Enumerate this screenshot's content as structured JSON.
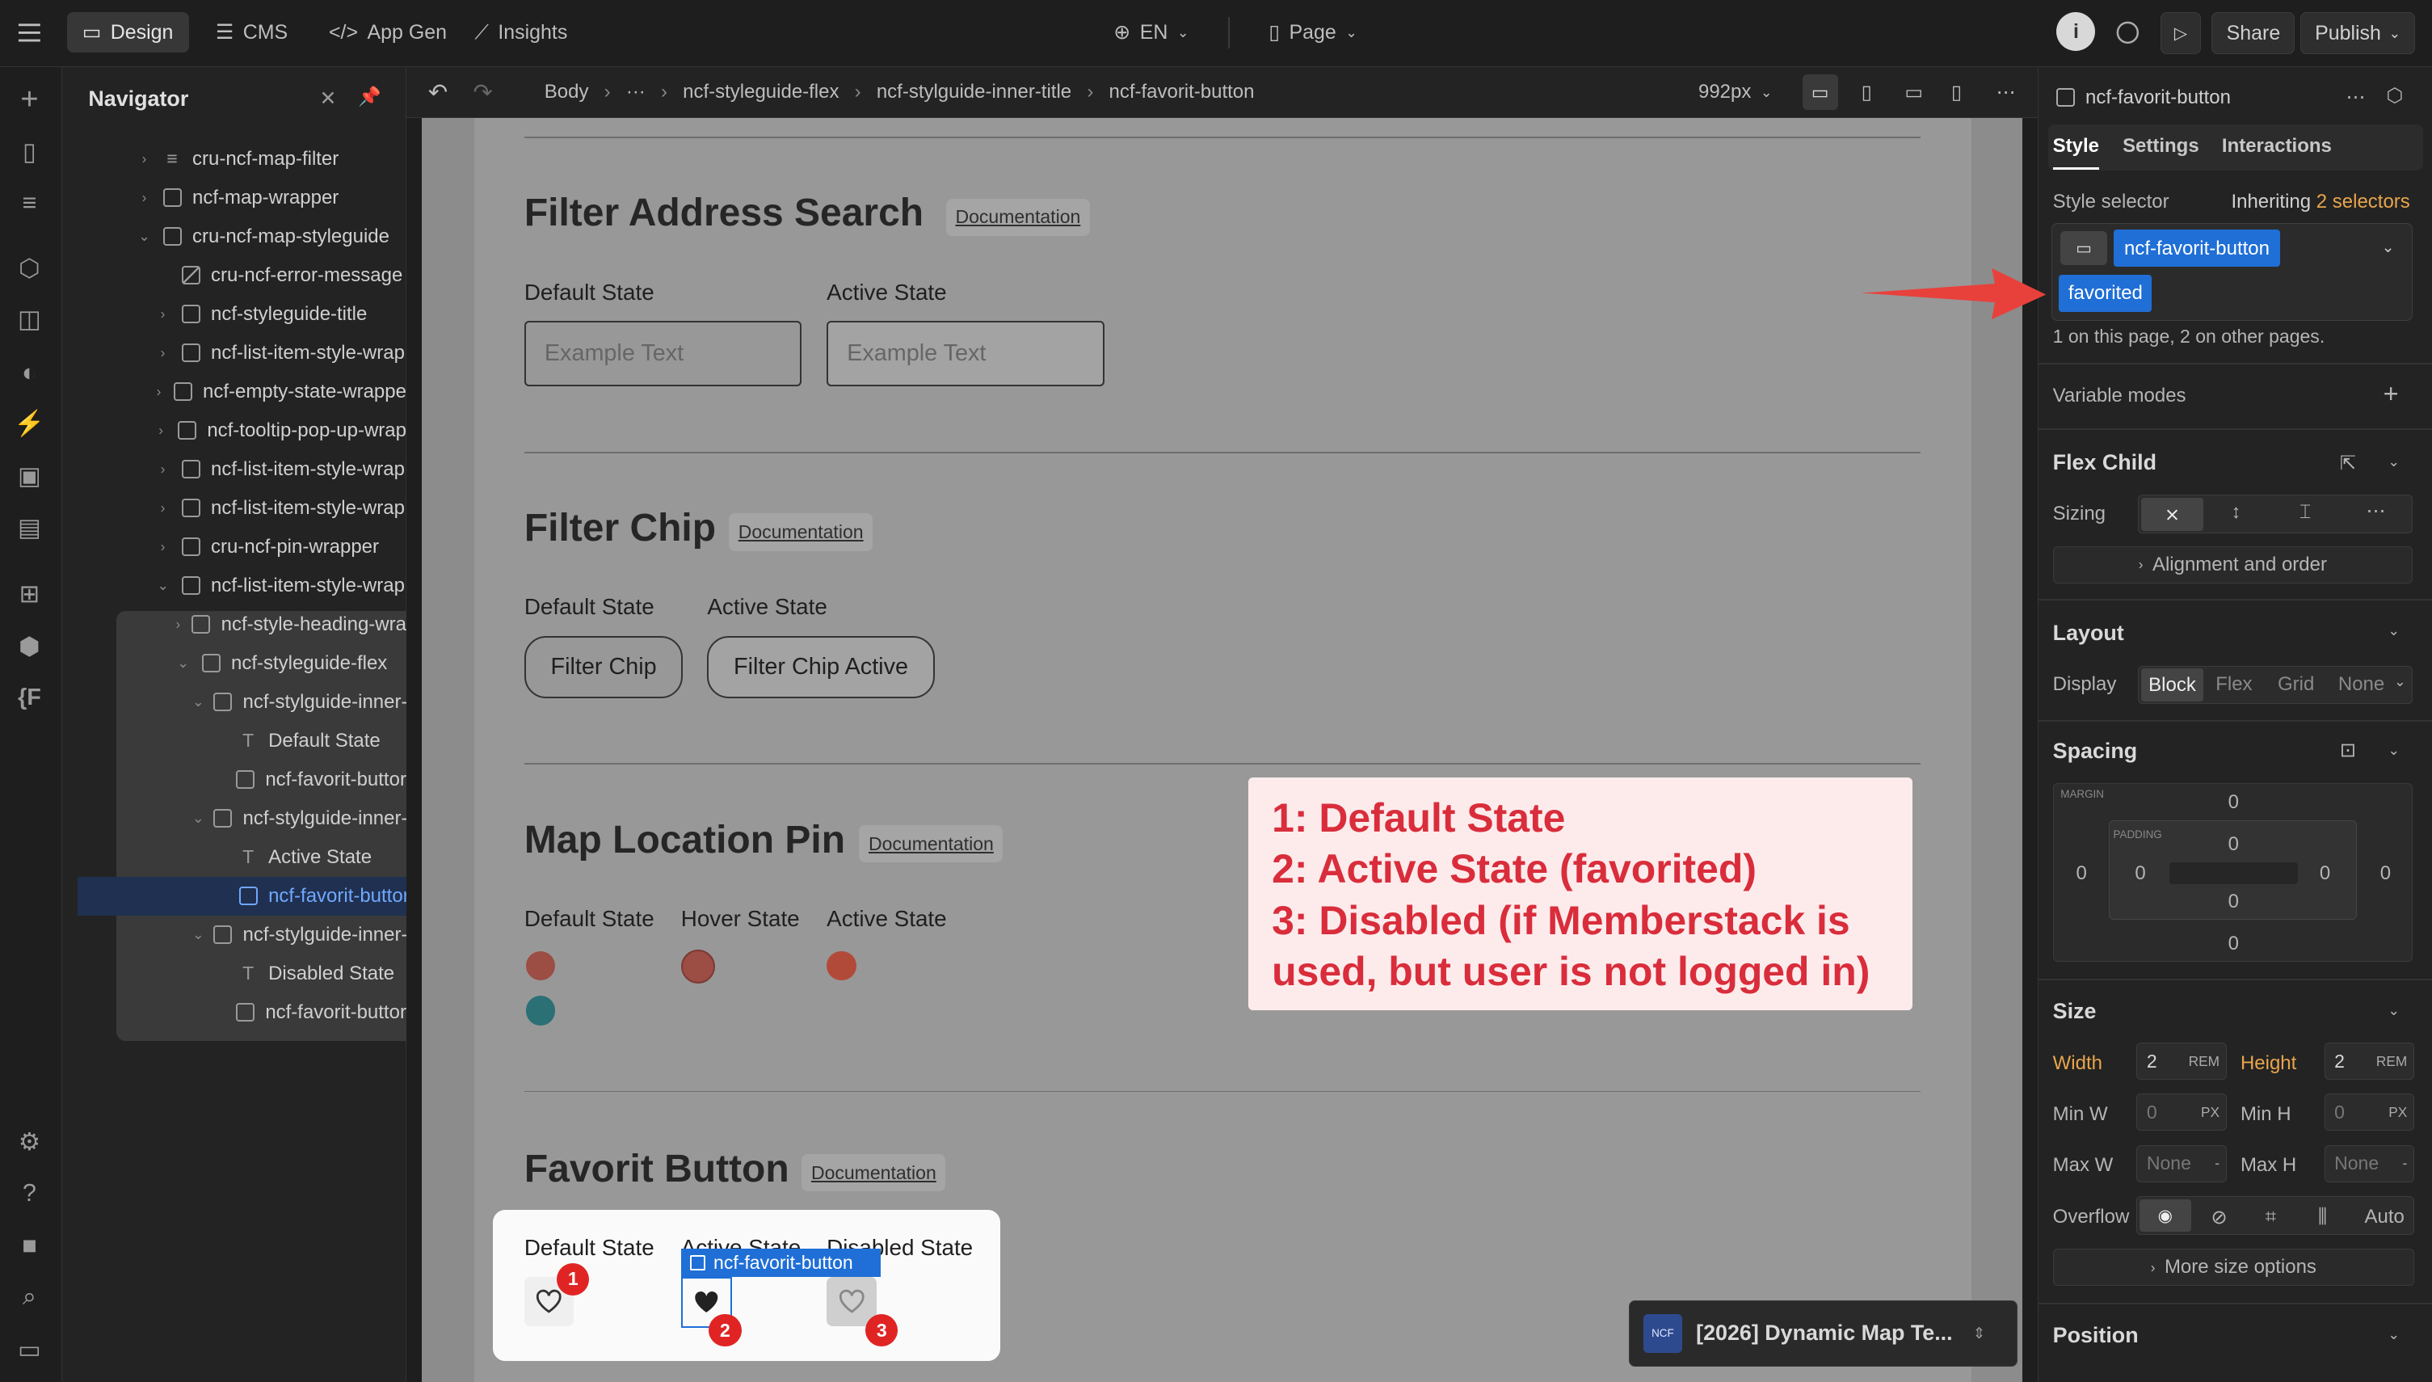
{
  "topbar": {
    "tabs": [
      "Design",
      "CMS",
      "App Gen",
      "Insights"
    ],
    "locale": "EN",
    "page": "Page",
    "share": "Share",
    "publish": "Publish"
  },
  "navigator": {
    "title": "Navigator",
    "items": [
      "cru-ncf-map-filter",
      "ncf-map-wrapper",
      "cru-ncf-map-styleguide",
      "cru-ncf-error-message",
      "ncf-styleguide-title",
      "ncf-list-item-style-wrap",
      "ncf-empty-state-wrappe",
      "ncf-tooltip-pop-up-wrap",
      "ncf-list-item-style-wrap",
      "ncf-list-item-style-wrap",
      "cru-ncf-pin-wrapper",
      "ncf-list-item-style-wrap",
      "ncf-style-heading-wra",
      "ncf-styleguide-flex",
      "ncf-stylguide-inner-",
      "Default State",
      "ncf-favorit-buttor",
      "ncf-stylguide-inner-",
      "Active State",
      "ncf-favorit-buttor",
      "ncf-stylguide-inner-",
      "Disabled State",
      "ncf-favorit-buttor"
    ]
  },
  "breadcrumb": {
    "items": [
      "Body",
      "···",
      "ncf-styleguide-flex",
      "ncf-stylguide-inner-title",
      "ncf-favorit-button"
    ],
    "breakpoint": "992px"
  },
  "canvas": {
    "filter_address": {
      "title": "Filter Address Search",
      "doc": "Documentation",
      "default_label": "Default State",
      "active_label": "Active State",
      "placeholder": "Example Text"
    },
    "filter_chip": {
      "title": "Filter Chip",
      "doc": "Documentation",
      "default_label": "Default State",
      "active_label": "Active State",
      "chip": "Filter Chip",
      "chip_active": "Filter Chip Active"
    },
    "map_pin": {
      "title": "Map Location Pin",
      "doc": "Documentation",
      "default_label": "Default State",
      "hover_label": "Hover State",
      "active_label": "Active State"
    },
    "favorit": {
      "title": "Favorit Button",
      "doc": "Documentation",
      "default_label": "Default State",
      "active_label": "Active State",
      "disabled_label": "Disabled State",
      "selected_tag": "ncf-favorit-button",
      "markers": [
        "1",
        "2",
        "3"
      ]
    }
  },
  "annotation": {
    "lines": [
      "1: Default State",
      "2: Active State (favorited)",
      "3: Disabled (if Memberstack is",
      "used, but user is not logged in)"
    ]
  },
  "project_badge": {
    "logo": "NCF",
    "name": "[2026] Dynamic Map Te..."
  },
  "right_panel": {
    "element": "ncf-favorit-button",
    "tabs": [
      "Style",
      "Settings",
      "Interactions"
    ],
    "style_selector": "Style selector",
    "inheriting": "Inheriting",
    "selectors_count": "2 selectors",
    "class_primary": "ncf-favorit-button",
    "class_combo": "favorited",
    "usage": "1 on this page, 2 on other pages.",
    "variable_modes": "Variable modes",
    "flex_child": "Flex Child",
    "sizing": "Sizing",
    "alignment": "Alignment and order",
    "layout": "Layout",
    "display": "Display",
    "display_options": [
      "Block",
      "Flex",
      "Grid",
      "None"
    ],
    "spacing": "Spacing",
    "margin": "MARGIN",
    "padding": "PADDING",
    "zero": "0",
    "size": "Size",
    "width": "Width",
    "height": "Height",
    "width_val": "2",
    "height_val": "2",
    "rem": "REM",
    "px": "PX",
    "min_w": "Min W",
    "min_h": "Min H",
    "min_val": "0",
    "max_w": "Max W",
    "max_h": "Max H",
    "none": "None",
    "dash": "-",
    "overflow": "Overflow",
    "auto": "Auto",
    "more_size": "More size options",
    "position": "Position"
  },
  "colors": {
    "accent_blue": "#1f6fd6",
    "annotation_red": "#d92d3b",
    "arrow_red": "#e8413c",
    "pin_red": "#b24a3a",
    "pin_teal": "#2a7075"
  }
}
